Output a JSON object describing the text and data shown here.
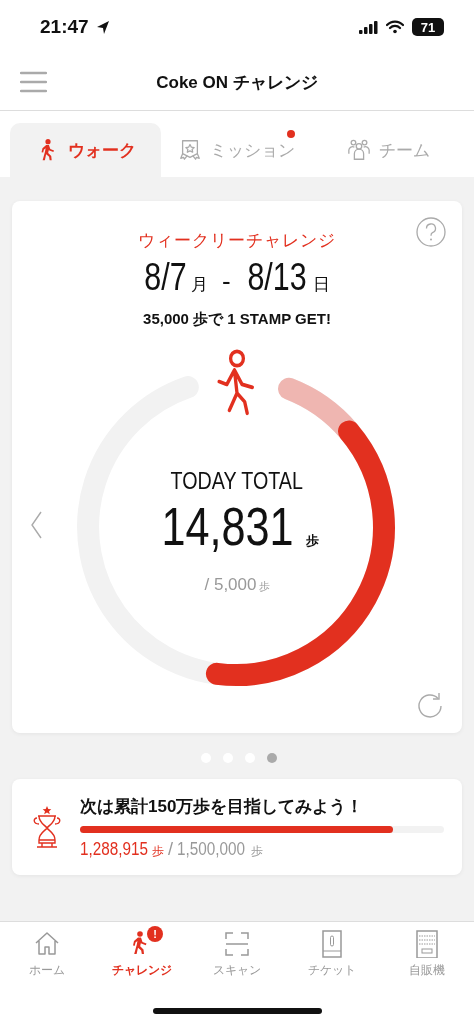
{
  "status_bar": {
    "time": "21:47",
    "battery": "71"
  },
  "header": {
    "title": "Coke ON チャレンジ"
  },
  "tabs": [
    {
      "kind": "walk",
      "label": "ウォーク",
      "selected": true,
      "badge": false
    },
    {
      "kind": "mission",
      "label": "ミッション",
      "selected": false,
      "badge": true
    },
    {
      "kind": "team",
      "label": "チーム",
      "selected": false,
      "badge": false
    }
  ],
  "challenge": {
    "heading": "ウィークリーチャレンジ",
    "start_date": "8/7",
    "start_day": "月",
    "separator": "-",
    "end_date": "8/13",
    "end_day": "日",
    "goal_text": "35,000 歩で 1 STAMP GET!",
    "today_label": "TODAY TOTAL",
    "today_steps": "14,831",
    "today_unit": "歩",
    "daily_target": "/ 5,000",
    "daily_unit": "歩"
  },
  "pager": [
    {
      "selected": false
    },
    {
      "selected": false
    },
    {
      "selected": false
    },
    {
      "selected": true
    }
  ],
  "milestone": {
    "message": "次は累計150万歩を目指してみよう！",
    "level": 0.86,
    "current": "1,288,915",
    "current_unit": "歩",
    "separator": "/",
    "target": "1,500,000",
    "target_unit": "歩"
  },
  "nav": [
    {
      "kind": "home",
      "label": "ホーム",
      "selected": false
    },
    {
      "kind": "challenge",
      "label": "チャレンジ",
      "selected": true,
      "badge": "!"
    },
    {
      "kind": "scan",
      "label": "スキャン",
      "selected": false
    },
    {
      "kind": "ticket",
      "label": "チケット",
      "selected": false
    },
    {
      "kind": "vending",
      "label": "自販機",
      "selected": false
    }
  ]
}
